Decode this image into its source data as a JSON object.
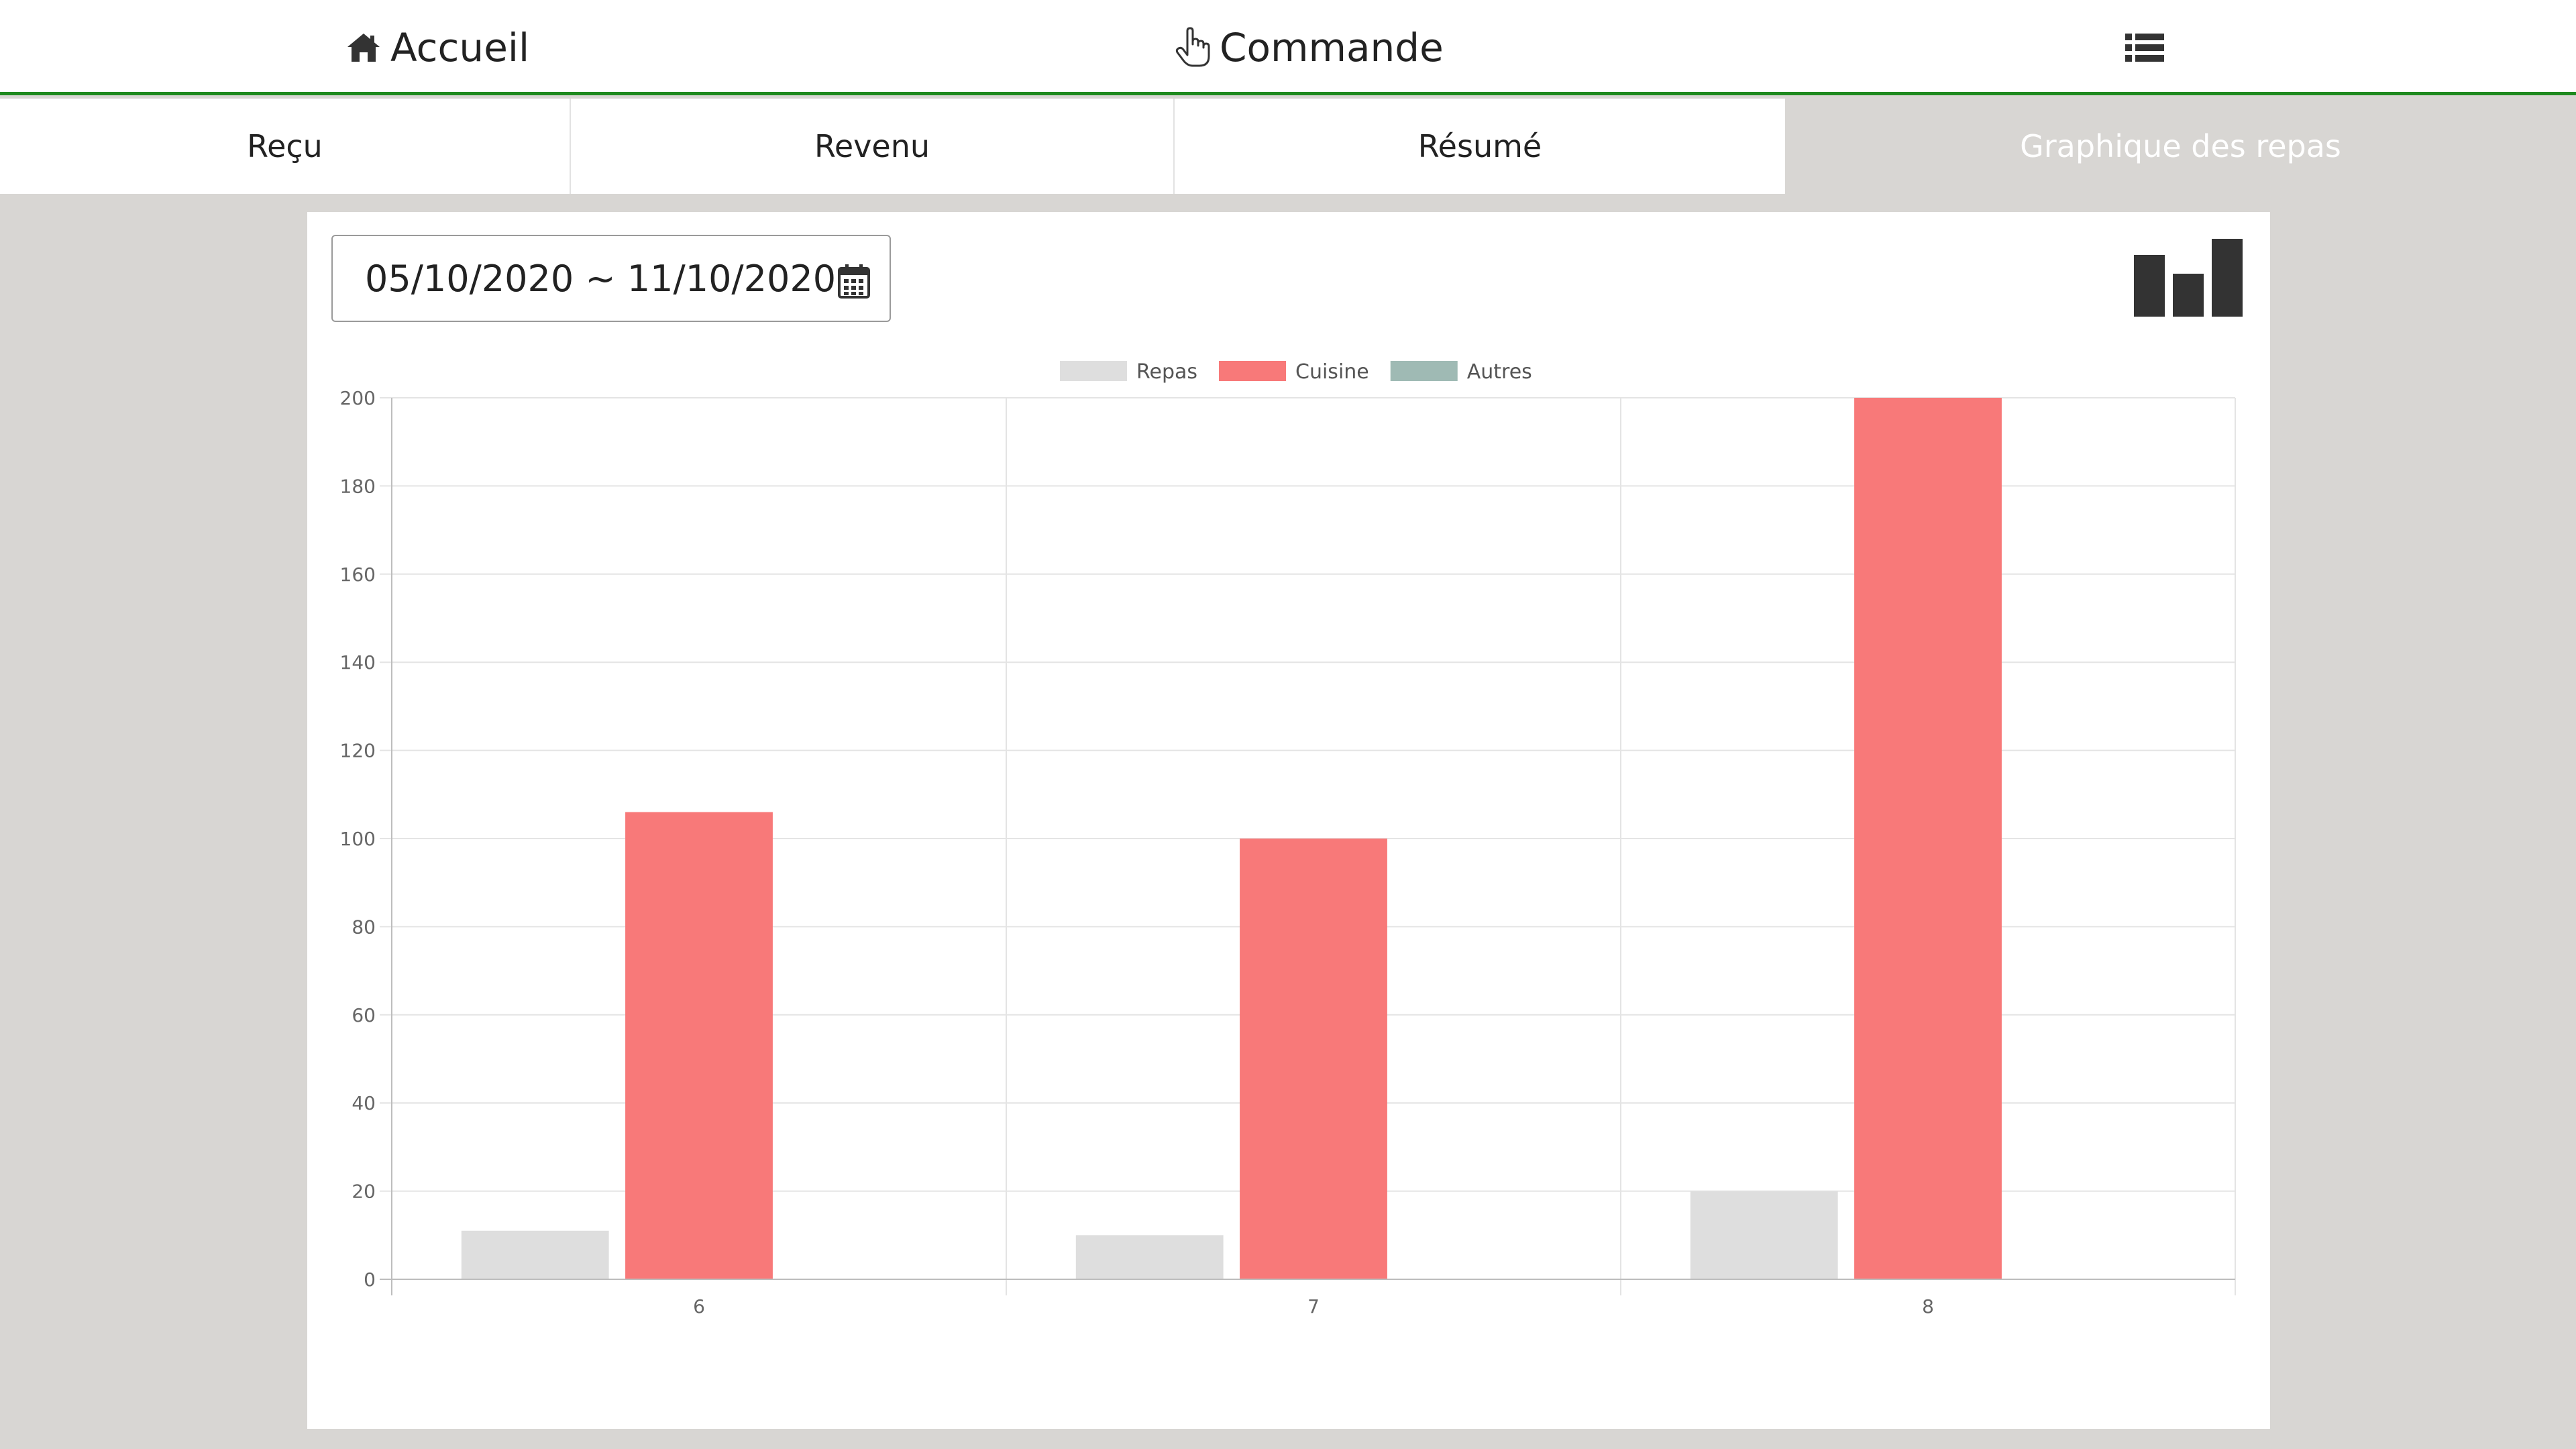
{
  "nav": {
    "home_label": "Accueil",
    "order_label": "Commande"
  },
  "tabs": [
    {
      "label": "Reçu"
    },
    {
      "label": "Revenu"
    },
    {
      "label": "Résumé"
    },
    {
      "label": "Graphique des repas"
    }
  ],
  "filter": {
    "date_range": "05/10/2020 ~ 11/10/2020"
  },
  "colors": {
    "nav_accent": "#1f8a1f",
    "background": "#d8d6d3"
  },
  "chart_data": {
    "type": "bar",
    "categories": [
      "6",
      "7",
      "8"
    ],
    "series": [
      {
        "name": "Repas",
        "values": [
          11,
          10,
          20
        ],
        "color": "#dedede"
      },
      {
        "name": "Cuisine",
        "values": [
          106,
          100,
          200
        ],
        "color": "#f87979"
      },
      {
        "name": "Autres",
        "values": [
          0,
          0,
          0
        ],
        "color": "#9fbab4"
      }
    ],
    "ylim": [
      0,
      200
    ],
    "yticks": [
      0,
      20,
      40,
      60,
      80,
      100,
      120,
      140,
      160,
      180,
      200
    ],
    "grid": true,
    "legend": "top-center"
  }
}
